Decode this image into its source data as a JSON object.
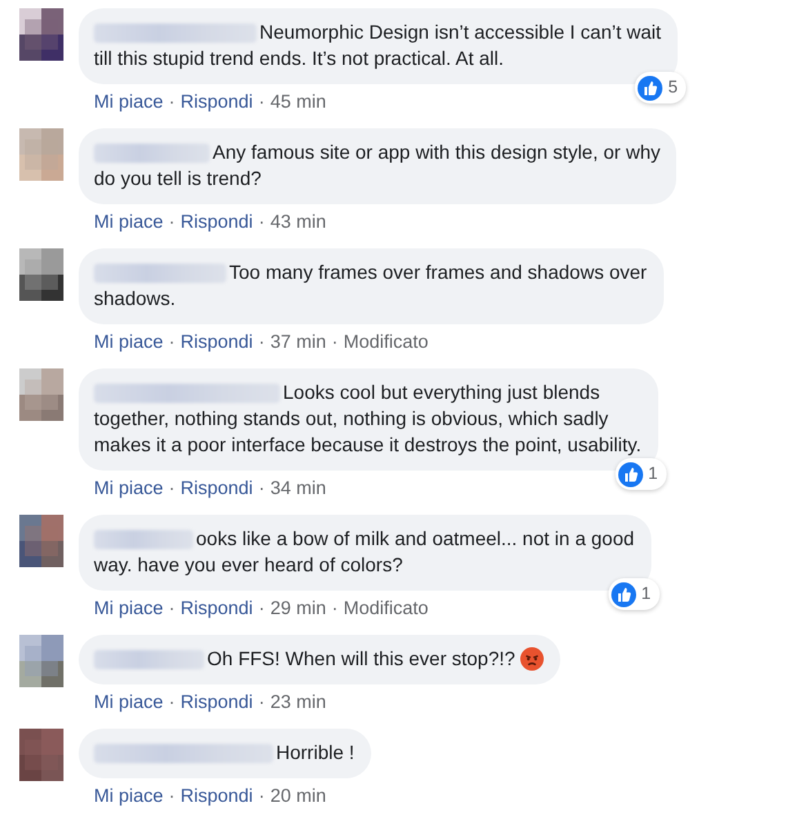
{
  "comments": [
    {
      "lines": [
        "Neumorphic Design isn’t accessible I can’t wait",
        "till this stupid trend ends. It’s not practical. At all."
      ],
      "like": "Mi piace",
      "reply": "Rispondi",
      "time": "45 min",
      "separator": "·",
      "reactions": "5"
    },
    {
      "lines": [
        "Any famous site or app with this design style, or why",
        "do you tell is trend?"
      ],
      "like": "Mi piace",
      "reply": "Rispondi",
      "time": "43 min",
      "separator": "·"
    },
    {
      "lines": [
        "Too many frames over frames and shadows over",
        "shadows."
      ],
      "like": "Mi piace",
      "reply": "Rispondi",
      "time": "37 min",
      "separator": "·",
      "edited": "Modificato"
    },
    {
      "lines": [
        "Looks cool but everything just blends",
        "together, nothing stands out, nothing is obvious, which sadly",
        "makes it a poor interface because it destroys the point, usability."
      ],
      "like": "Mi piace",
      "reply": "Rispondi",
      "time": "34 min",
      "separator": "·",
      "reactions": "1"
    },
    {
      "lines": [
        "ooks like a bow of milk and oatmeel... not in a good",
        "way. have you ever heard of colors?"
      ],
      "like": "Mi piace",
      "reply": "Rispondi",
      "time": "29 min",
      "separator": "·",
      "edited": "Modificato",
      "reactions": "1"
    },
    {
      "lines": [
        "Oh FFS! When will this ever stop?!?"
      ],
      "angry_emoji": true,
      "like": "Mi piace",
      "reply": "Rispondi",
      "time": "23 min",
      "separator": "·"
    },
    {
      "lines": [
        "Horrible !"
      ],
      "like": "Mi piace",
      "reply": "Rispondi",
      "time": "20 min",
      "separator": "·"
    }
  ]
}
